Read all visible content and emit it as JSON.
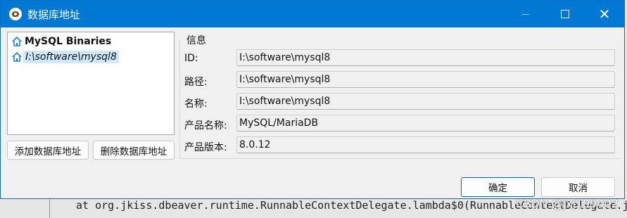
{
  "window": {
    "title": "数据库地址"
  },
  "tree": {
    "items": [
      {
        "label": "MySQL Binaries"
      },
      {
        "label": "I:\\software\\mysql8"
      }
    ]
  },
  "buttons": {
    "add": "添加数据库地址",
    "delete": "删除数据库地址",
    "ok": "确定",
    "cancel": "取消"
  },
  "info": {
    "group_title": "信息",
    "rows": [
      {
        "label": "ID:",
        "value": "I:\\software\\mysql8"
      },
      {
        "label": "路径:",
        "value": "I:\\software\\mysql8"
      },
      {
        "label": "名称:",
        "value": "I:\\software\\mysql8"
      },
      {
        "label": "产品名称:",
        "value": "MySQL/MariaDB"
      },
      {
        "label": "产品版本:",
        "value": "8.0.12"
      }
    ]
  },
  "background": {
    "console_line": "at org.jkiss.dbeaver.runtime.RunnableContextDelegate.lambda$0(RunnableContextDelegate.j",
    "watermark": "CSDN @jxj199402"
  },
  "colors": {
    "titlebar": "#0078d4",
    "selection": "#cde8ff",
    "primary_button_border": "#0067c0"
  }
}
